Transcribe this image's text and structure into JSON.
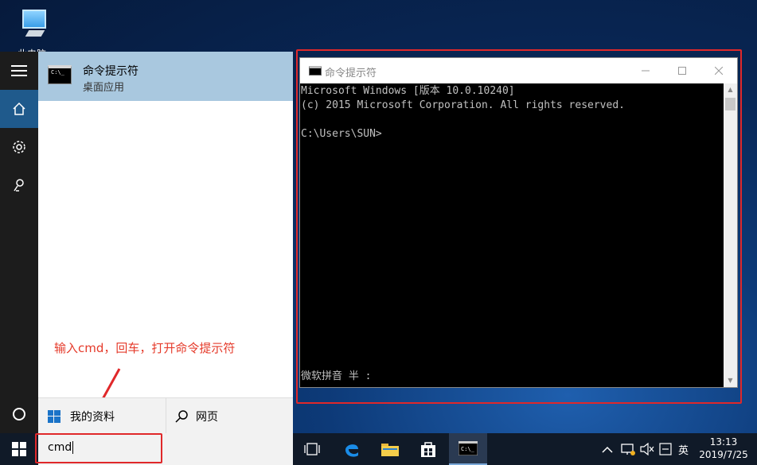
{
  "desktop": {
    "icon_label": "此电脑"
  },
  "start_menu": {
    "result_title": "命令提示符",
    "result_subtitle": "桌面应用",
    "scope_mine": "我的资料",
    "scope_web": "网页",
    "annotation": "输入cmd，回车，打开命令提示符"
  },
  "search": {
    "value": "cmd"
  },
  "cmd_window": {
    "title": "命令提示符",
    "line1": "Microsoft Windows [版本 10.0.10240]",
    "line2": "(c) 2015 Microsoft Corporation. All rights reserved.",
    "prompt": "C:\\Users\\SUN>",
    "ime_status": "微软拼音 半 :"
  },
  "taskbar": {
    "tray_lang": "英"
  },
  "clock": {
    "time": "13:13",
    "date": "2019/7/25"
  },
  "colors": {
    "annotation": "#e53a2a",
    "highlight": "#a9c8df",
    "rail_active": "#1f5a8c"
  }
}
